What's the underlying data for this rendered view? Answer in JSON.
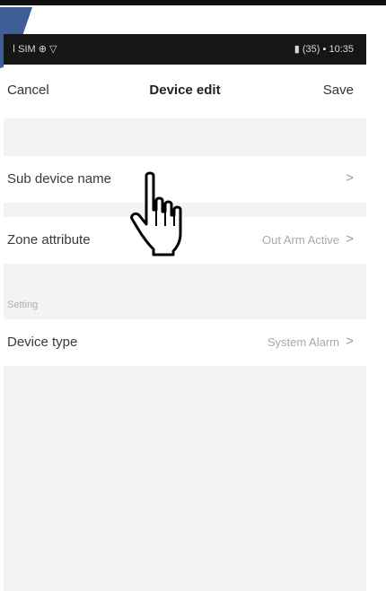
{
  "status_bar": {
    "left_text": "ا SIM ⊕ ▽",
    "right_text": "▮ (35) ▪ 10:35"
  },
  "nav": {
    "cancel_label": "Cancel",
    "title": "Device edit",
    "save_label": "Save"
  },
  "rows": {
    "sub_device_name": {
      "label": "Sub device name",
      "chevron": ">"
    },
    "zone_attribute": {
      "label": "Zone attribute",
      "value": "Out Arm Active",
      "chevron": ">"
    },
    "device_type": {
      "label": "Device type",
      "value": "System Alarm",
      "chevron": ">"
    }
  },
  "sections": {
    "setting_header": "Setting"
  },
  "icons": {
    "pointer": "hand-pointer-icon",
    "corner": "corner-flag-icon"
  },
  "colors": {
    "status_bar_bg": "#161616",
    "page_bg": "#f3f3f3",
    "row_bg": "#ffffff",
    "secondary_text": "#a8a8a8",
    "corner_flag": "#3d5f95"
  }
}
